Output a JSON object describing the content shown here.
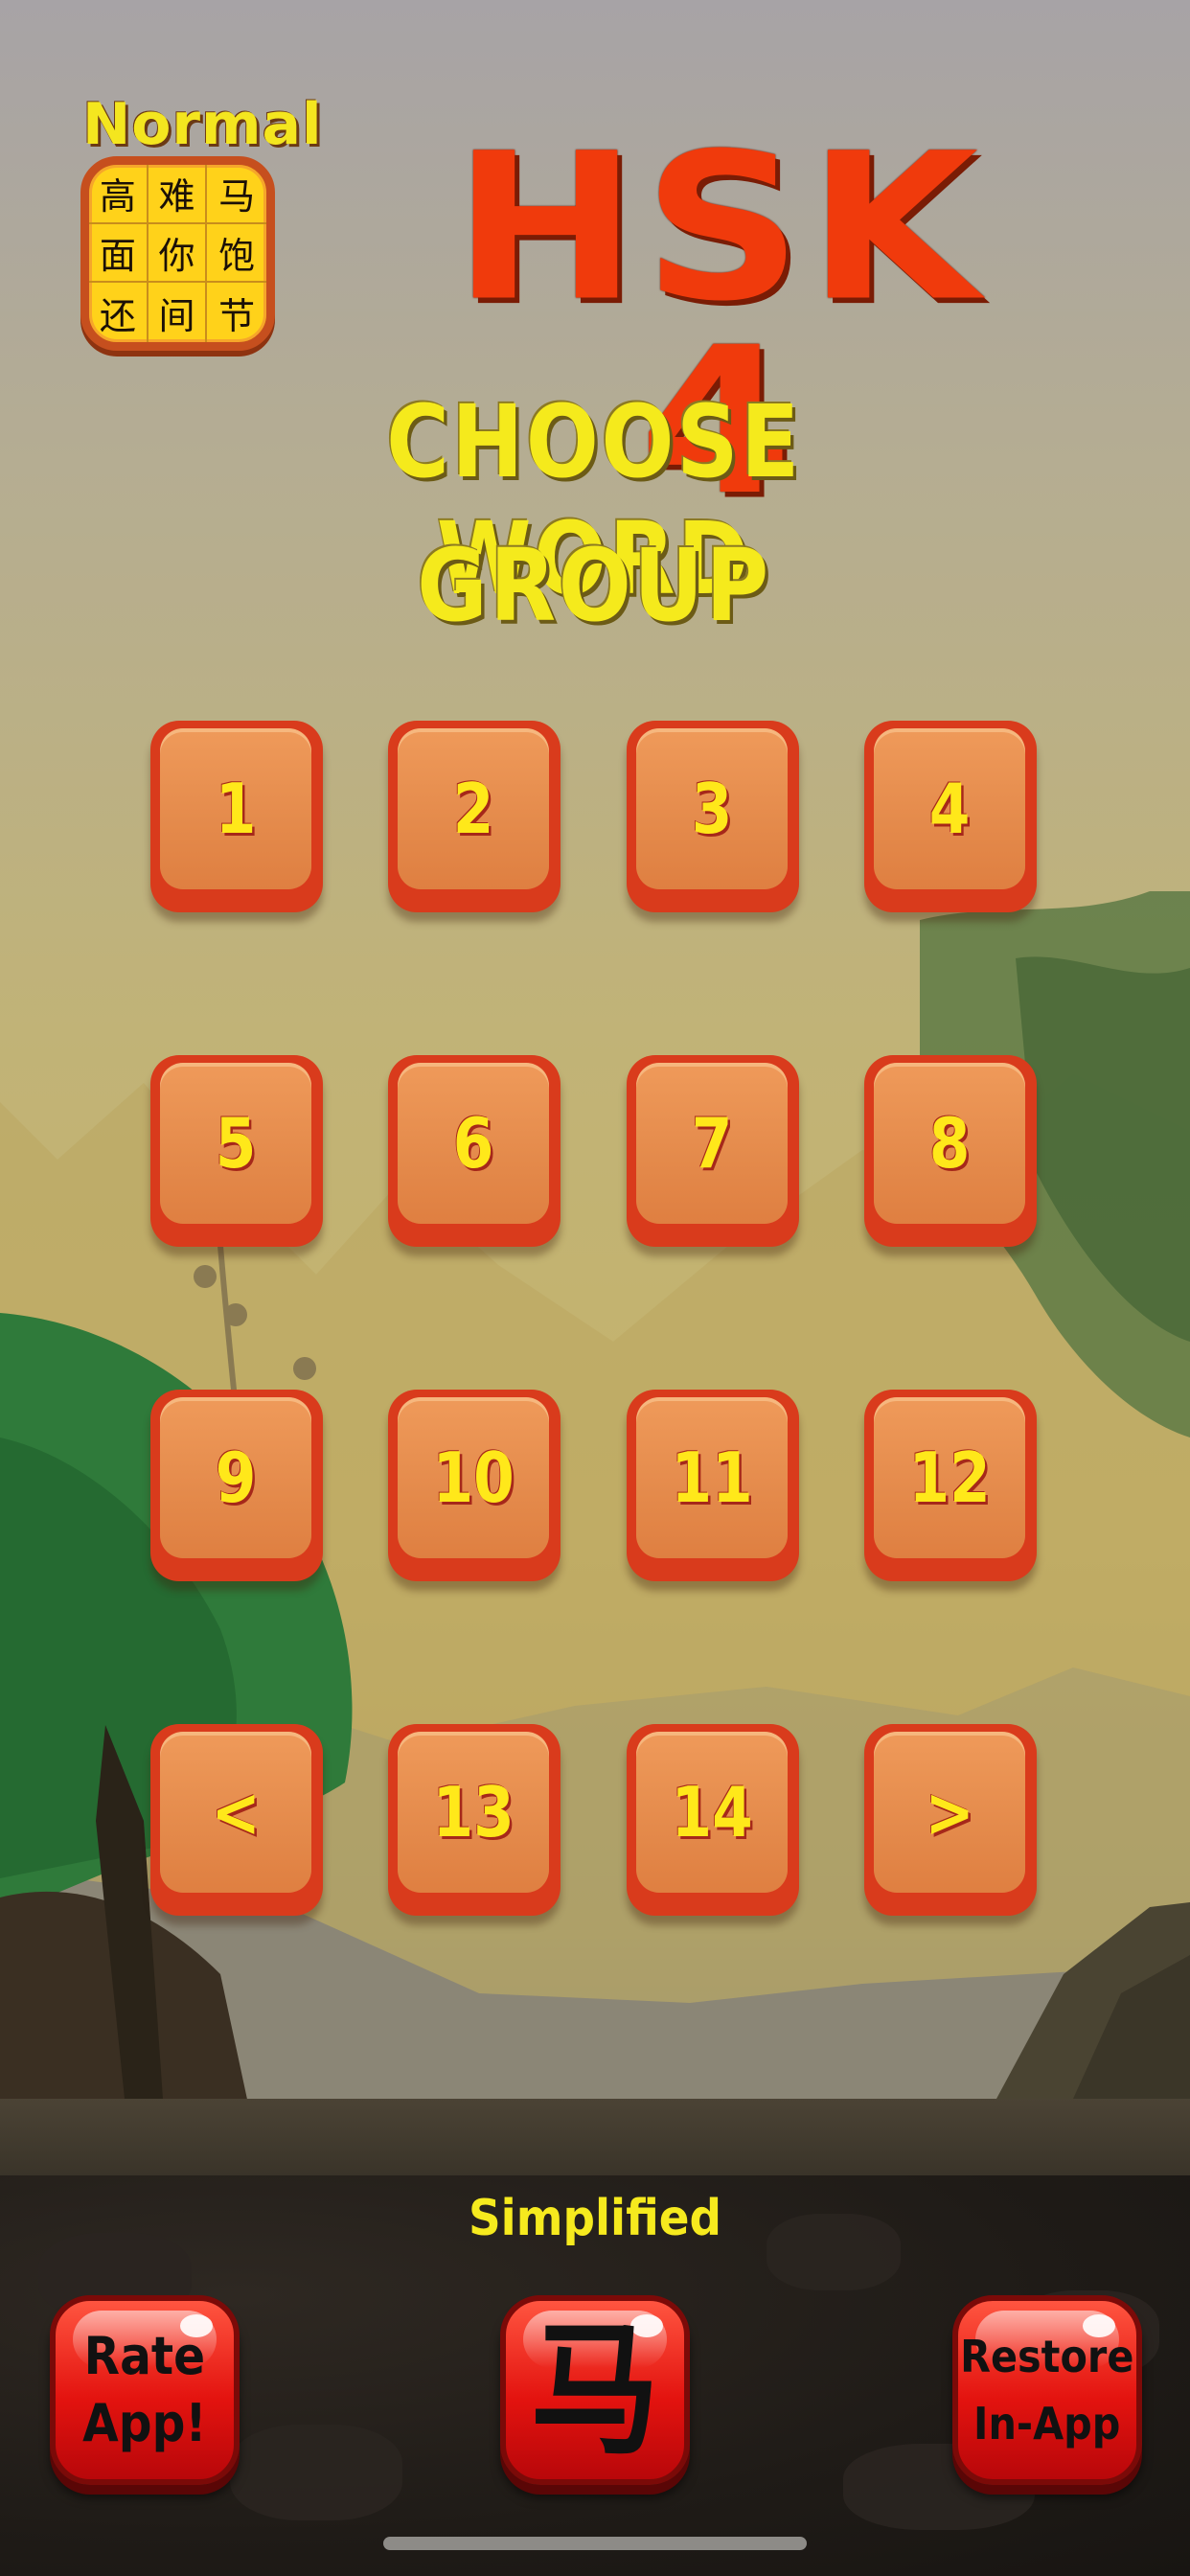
{
  "mode": {
    "label": "Normal",
    "grid_chars": [
      "高",
      "难",
      "马",
      "面",
      "你",
      "饱",
      "还",
      "间",
      "节"
    ]
  },
  "title": "HSK 4",
  "subtitle_line1": "CHOOSE WORD",
  "subtitle_line2": "GROUP",
  "groups": [
    {
      "label": "1"
    },
    {
      "label": "2"
    },
    {
      "label": "3"
    },
    {
      "label": "4"
    },
    {
      "label": "5"
    },
    {
      "label": "6"
    },
    {
      "label": "7"
    },
    {
      "label": "8"
    },
    {
      "label": "9"
    },
    {
      "label": "10"
    },
    {
      "label": "11"
    },
    {
      "label": "12"
    },
    {
      "label": "<"
    },
    {
      "label": "13"
    },
    {
      "label": "14"
    },
    {
      "label": ">"
    }
  ],
  "script_mode": "Simplified",
  "buttons": {
    "rate": "Rate\nApp!",
    "horse": "马",
    "restore": "Restore\nIn-App"
  },
  "colors": {
    "title_red": "#f03a0c",
    "subtitle_yellow": "#f5ea1c",
    "tile_orange": "#e48a4b",
    "button_red": "#e3130f"
  }
}
